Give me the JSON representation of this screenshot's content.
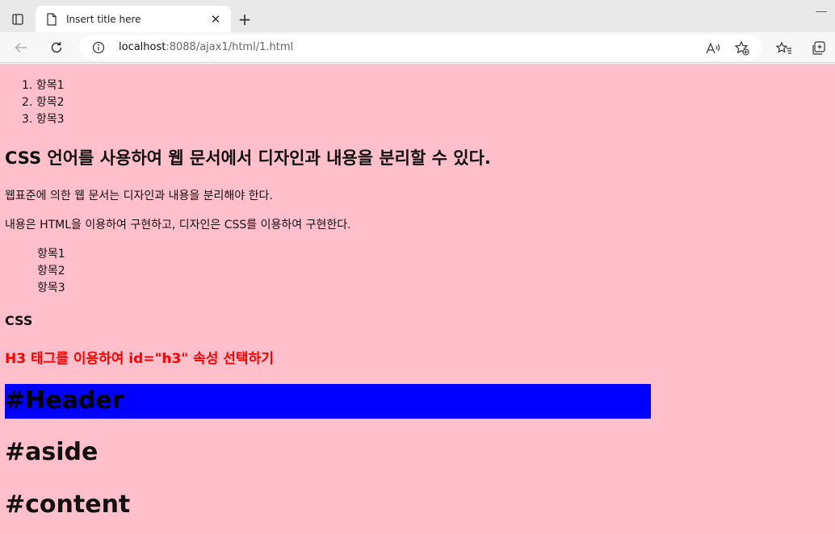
{
  "browser": {
    "tab": {
      "title": "Insert title here",
      "close_glyph": "✕"
    },
    "new_tab_glyph": "+",
    "address": {
      "host": "localhost",
      "rest": ":8088/ajax1/html/1.html"
    },
    "icons": {
      "tab_actions": "tab-actions-icon",
      "favicon": "document-icon",
      "back": "back-arrow-icon",
      "reload": "reload-icon",
      "site_info": "info-icon",
      "read_aloud": "read-aloud-icon",
      "add_favorite": "star-plus-icon",
      "favorites": "favorites-icon",
      "collections": "collections-icon"
    }
  },
  "page": {
    "background": "#ffc0cb",
    "ordered_list": [
      {
        "num": "1.",
        "text": "항목1"
      },
      {
        "num": "2.",
        "text": "항목2"
      },
      {
        "num": "3.",
        "text": "항목3"
      }
    ],
    "heading2": "CSS 언어를 사용하여 웹 문서에서 디자인과 내용을 분리할 수 있다.",
    "paragraph1": "웹표준에 의한 웹 문서는 디자인과 내용을 분리해야 한다.",
    "paragraph2": "내용은 HTML을 이용하여 구현하고, 디자인은 CSS를 이용하여 구현한다.",
    "definition_list": [
      "항목1",
      "항목2",
      "항목3"
    ],
    "heading3_css": "CSS",
    "heading3_red": "H3 태그를 이용하여 id=\"h3\" 속성 선택하기",
    "heading3_red_color": "#ff0000",
    "header_box": {
      "text": "#Header",
      "color": "#0000ff"
    },
    "aside": "#aside",
    "content": "#content"
  }
}
